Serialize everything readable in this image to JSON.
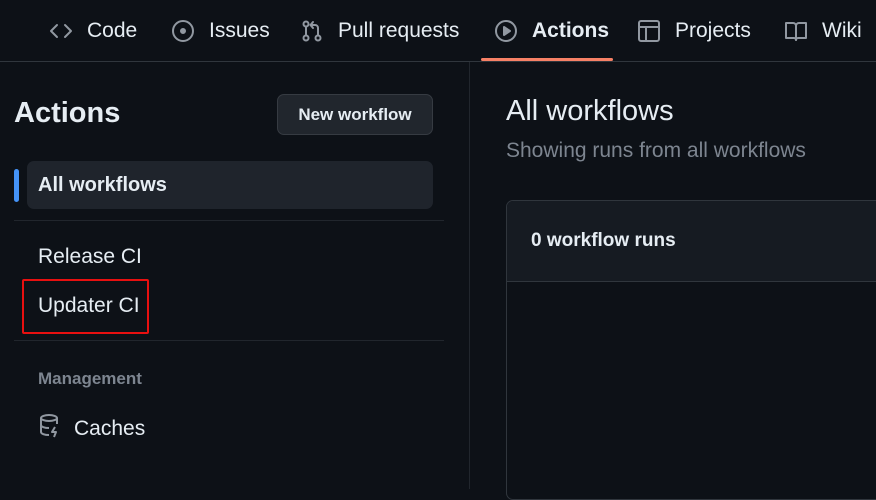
{
  "tabs": [
    {
      "label": "Code",
      "icon": "code-icon"
    },
    {
      "label": "Issues",
      "icon": "issue-circle-icon"
    },
    {
      "label": "Pull requests",
      "icon": "pull-request-icon"
    },
    {
      "label": "Actions",
      "icon": "play-circle-icon",
      "active": true
    },
    {
      "label": "Projects",
      "icon": "table-icon"
    },
    {
      "label": "Wiki",
      "icon": "book-icon"
    }
  ],
  "sidebar": {
    "title": "Actions",
    "new_workflow_label": "New workflow",
    "all_workflows_label": "All workflows",
    "workflows": [
      "Release CI",
      "Updater CI"
    ],
    "management_label": "Management",
    "caches_label": "Caches"
  },
  "main": {
    "title": "All workflows",
    "subtitle": "Showing runs from all workflows",
    "runs_count_label": "0 workflow runs"
  },
  "colors": {
    "background": "#0d1117",
    "accent_underline": "#f78166",
    "active_bar": "#4493f8",
    "highlight_box": "#e81010"
  }
}
